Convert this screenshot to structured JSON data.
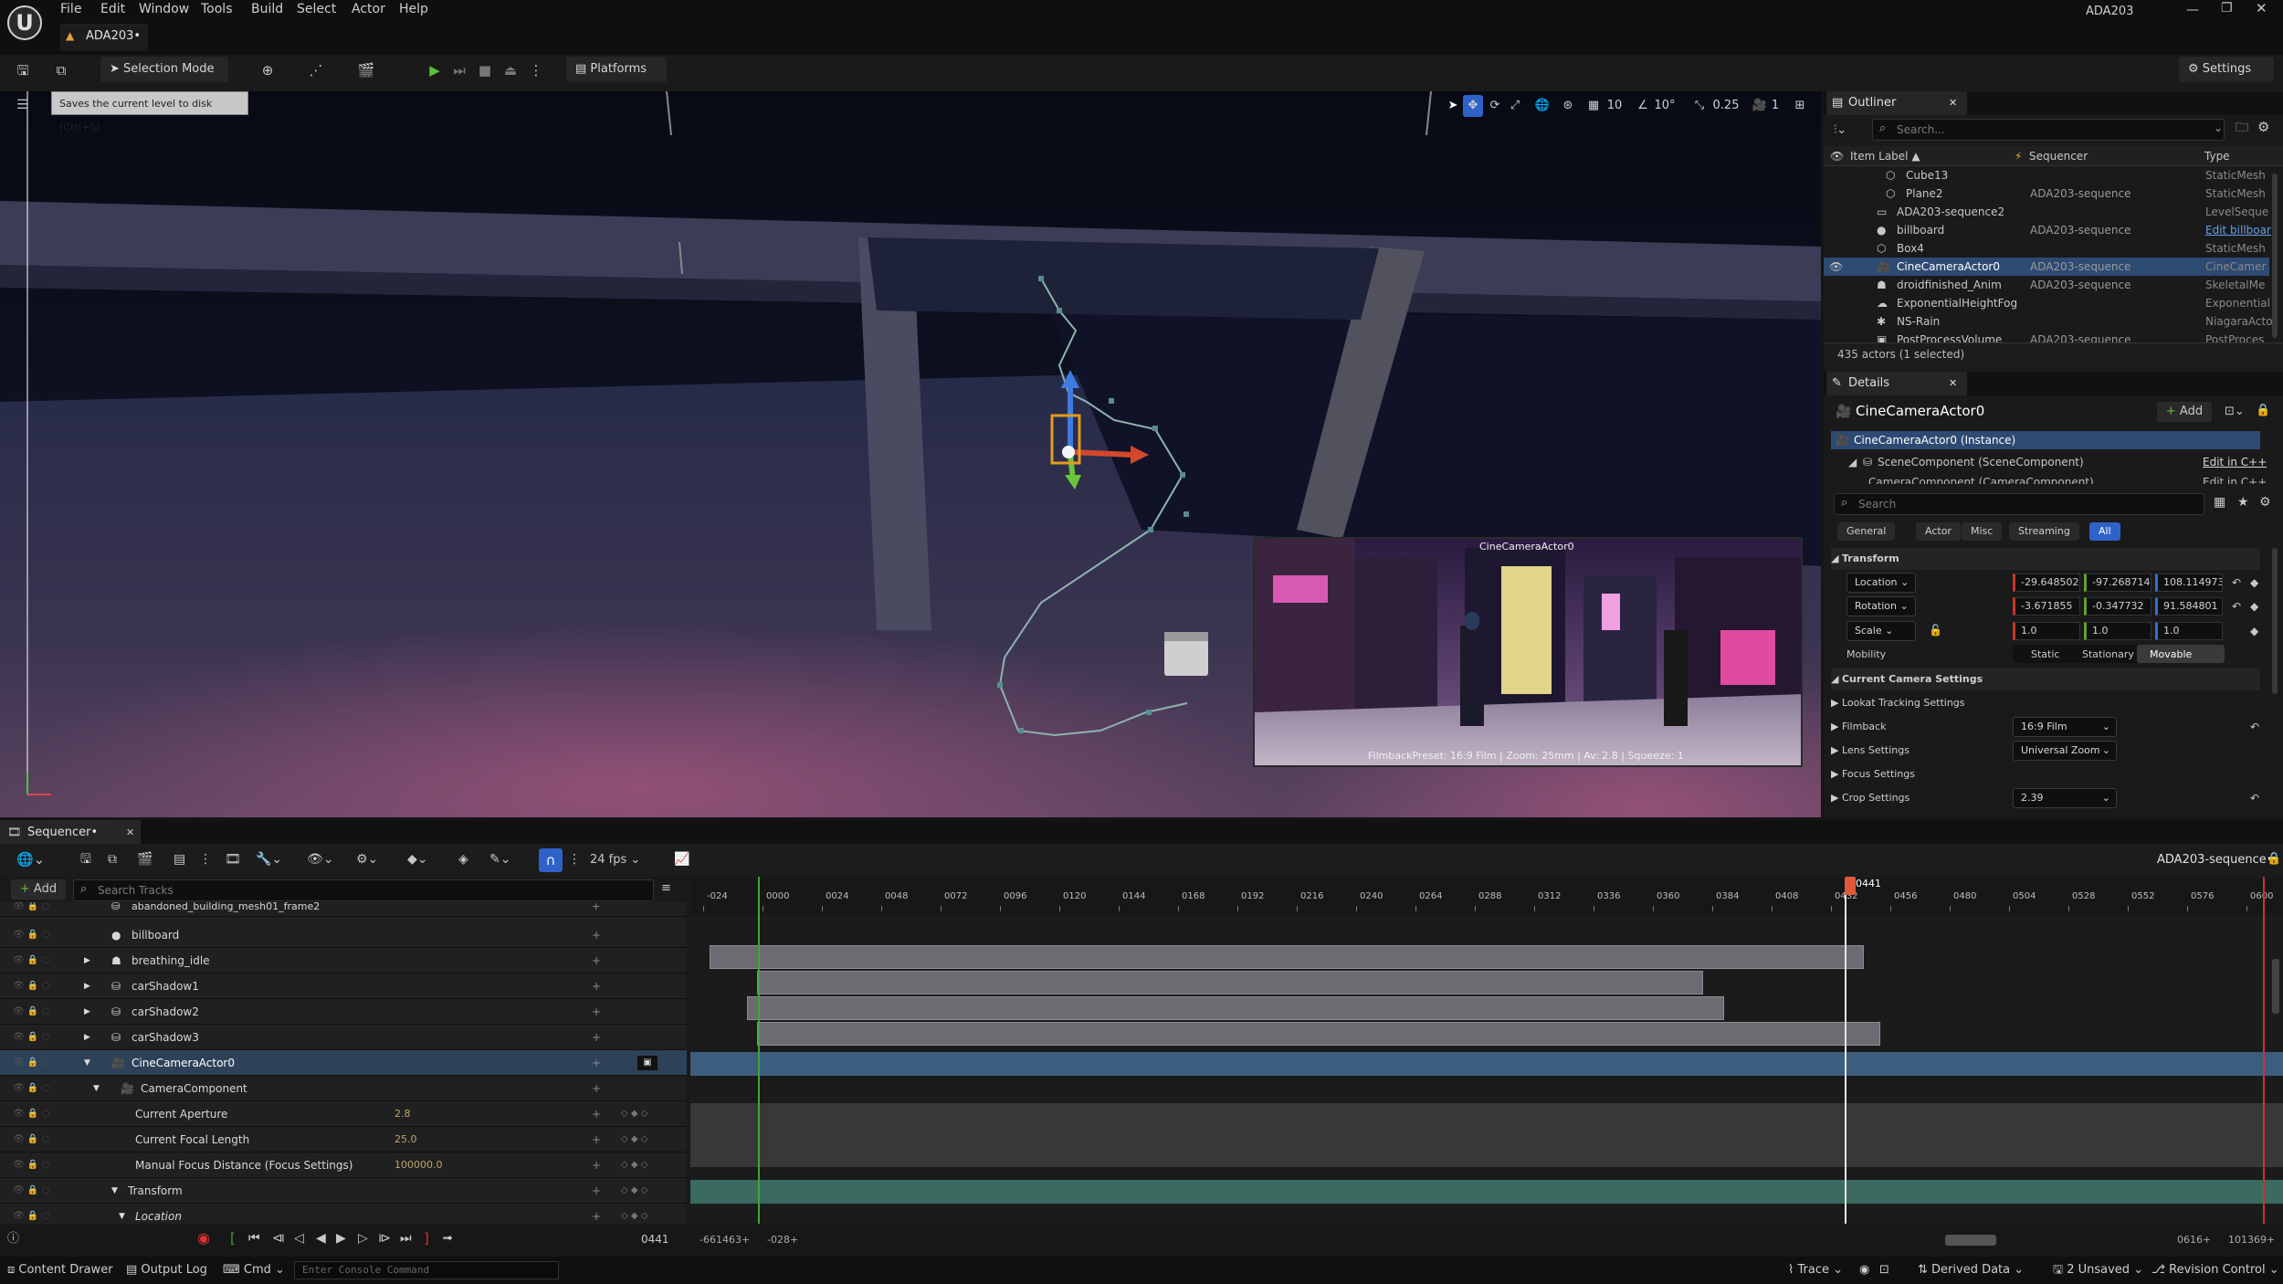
{
  "app": {
    "window_title": "ADA203",
    "doc_tab": "ADA203•"
  },
  "menu": [
    "File",
    "Edit",
    "Window",
    "Tools",
    "Build",
    "Select",
    "Actor",
    "Help"
  ],
  "toolbar": {
    "selection_mode": "Selection Mode",
    "platforms": "Platforms",
    "settings": "Settings"
  },
  "tooltip": "Saves the current level to disk (Ctrl+S)",
  "viewport": {
    "grid_snap": "10",
    "rot_snap": "10°",
    "scale_snap": "0.25",
    "cam_speed": "1",
    "pip_title": "CineCameraActor0",
    "pip_caption": "FilmbackPreset: 16:9 Film | Zoom: 25mm | Av: 2.8 | Squeeze: 1"
  },
  "outliner": {
    "title": "Outliner",
    "search_placeholder": "Search...",
    "cols": {
      "label": "Item Label ▲",
      "seq": "Sequencer",
      "type": "Type"
    },
    "rows": [
      {
        "label": "Cube13",
        "seq": "",
        "type": "StaticMesh"
      },
      {
        "label": "Plane2",
        "seq": "ADA203-sequence",
        "type": "StaticMesh"
      },
      {
        "label": "ADA203-sequence2",
        "seq": "",
        "type": "LevelSeque"
      },
      {
        "label": "billboard",
        "seq": "ADA203-sequence",
        "type": "Edit billboar"
      },
      {
        "label": "Box4",
        "seq": "",
        "type": "StaticMesh"
      },
      {
        "label": "CineCameraActor0",
        "seq": "ADA203-sequence",
        "type": "CineCamer"
      },
      {
        "label": "droidfinished_Anim",
        "seq": "ADA203-sequence",
        "type": "SkeletalMe"
      },
      {
        "label": "ExponentialHeightFog",
        "seq": "",
        "type": "Exponential"
      },
      {
        "label": "NS-Rain",
        "seq": "",
        "type": "NiagaraActo"
      },
      {
        "label": "PostProcessVolume",
        "seq": "ADA203-sequence",
        "type": "PostProces"
      }
    ],
    "footer": "435 actors (1 selected)"
  },
  "details": {
    "title": "Details",
    "actor": "CineCameraActor0",
    "add": "Add",
    "instance": "CineCameraActor0 (Instance)",
    "scene_comp": "SceneComponent (SceneComponent)",
    "camera_comp": "CameraComponent (CameraComponent)",
    "edit_cpp": "Edit in C++",
    "search_placeholder": "Search",
    "filters": [
      "General",
      "Actor",
      "Misc",
      "Streaming",
      "All"
    ],
    "transform": "Transform",
    "location_label": "Location",
    "location": [
      "-29.648502",
      "-97.268714",
      "108.114973"
    ],
    "rotation_label": "Rotation",
    "rotation": [
      "-3.671855 °",
      "-0.347732 °",
      "91.584801 °"
    ],
    "scale_label": "Scale",
    "scale": [
      "1.0",
      "1.0",
      "1.0"
    ],
    "mobility_label": "Mobility",
    "mobility": [
      "Static",
      "Stationary",
      "Movable"
    ],
    "cam_settings": "Current Camera Settings",
    "lookat": "Lookat Tracking Settings",
    "filmback_label": "Filmback",
    "filmback": "16:9 Film",
    "lens_label": "Lens Settings",
    "lens": "Universal Zoom",
    "focus_label": "Focus Settings",
    "crop_label": "Crop Settings",
    "crop": "2.39"
  },
  "sequencer": {
    "title": "Sequencer•",
    "fps": "24 fps",
    "add": "Add",
    "search_placeholder": "Search Tracks",
    "sequence_name": "ADA203-sequence•",
    "playhead": "0441",
    "ticks": [
      "-024",
      "0000",
      "0024",
      "0048",
      "0072",
      "0096",
      "0120",
      "0144",
      "0168",
      "0192",
      "0216",
      "0240",
      "0264",
      "0288",
      "0312",
      "0336",
      "0360",
      "0384",
      "0408",
      "0432",
      "0456",
      "0480",
      "0504",
      "0528",
      "0552",
      "0576",
      "0600"
    ],
    "tracks": [
      {
        "name": "abandoned_building_mesh01_frame2",
        "value": ""
      },
      {
        "name": "billboard",
        "value": ""
      },
      {
        "name": "breathing_idle",
        "value": ""
      },
      {
        "name": "carShadow1",
        "value": ""
      },
      {
        "name": "carShadow2",
        "value": ""
      },
      {
        "name": "carShadow3",
        "value": ""
      },
      {
        "name": "CineCameraActor0",
        "value": ""
      },
      {
        "name": "CameraComponent",
        "value": ""
      },
      {
        "name": "Current Aperture",
        "value": "2.8"
      },
      {
        "name": "Current Focal Length",
        "value": "25.0"
      },
      {
        "name": "Manual Focus Distance (Focus Settings)",
        "value": "100000.0"
      },
      {
        "name": "Transform",
        "value": ""
      },
      {
        "name": "Location",
        "value": ""
      }
    ],
    "bottom": {
      "frame": "0441",
      "range_start": "-661463+",
      "range_start2": "-028+",
      "range_end1": "0616+",
      "range_end2": "101369+"
    }
  },
  "status": {
    "content_drawer": "Content Drawer",
    "output_log": "Output Log",
    "cmd": "Cmd",
    "console_placeholder": "Enter Console Command",
    "trace": "Trace",
    "derived": "Derived Data",
    "unsaved": "2 Unsaved",
    "revision": "Revision Control"
  }
}
